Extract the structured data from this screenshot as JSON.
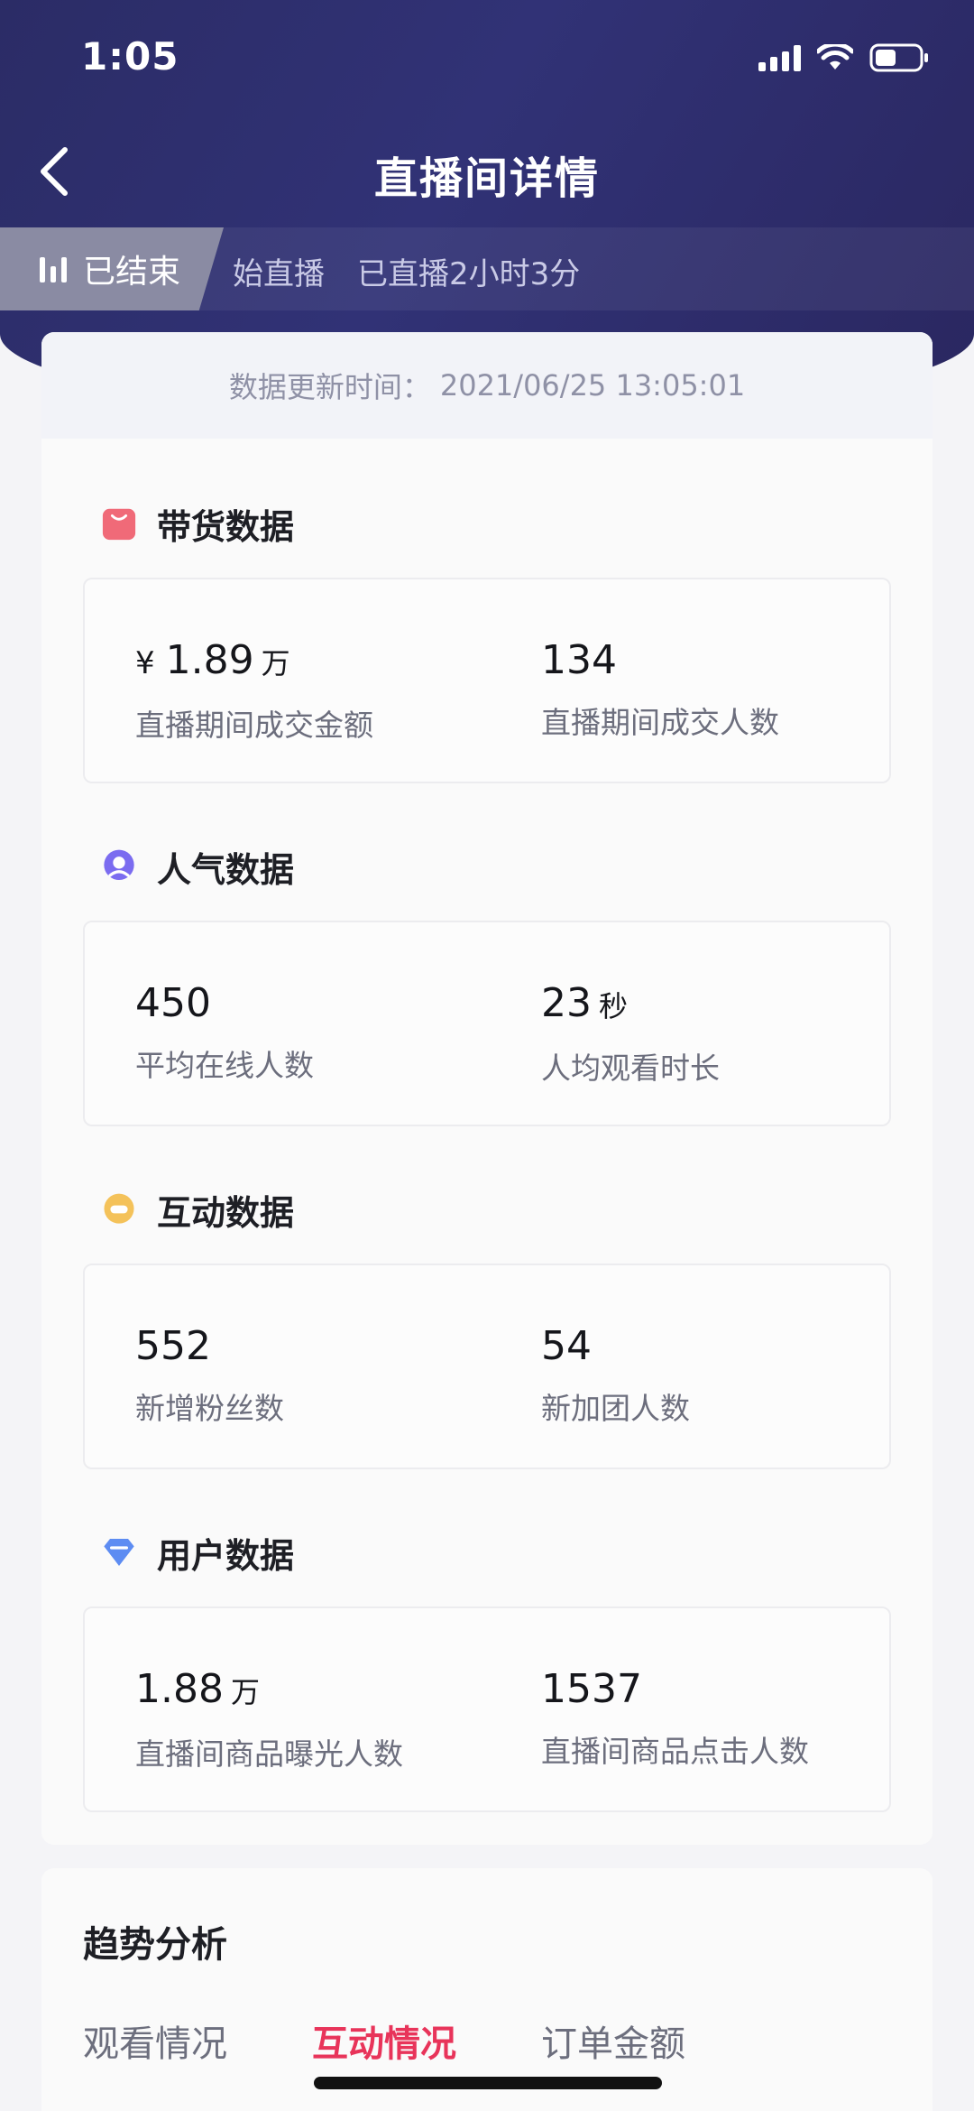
{
  "status_bar": {
    "time": "1:05"
  },
  "nav": {
    "title": "直播间详情"
  },
  "live": {
    "status": "已结束",
    "start_text": "始直播",
    "duration_text": "已直播2小时3分"
  },
  "update": {
    "label": "数据更新时间：",
    "value": "2021/06/25 13:05:01"
  },
  "sections": [
    {
      "title": "带货数据",
      "icon": "shopping-bag-icon",
      "color": "#f06a78",
      "stats": [
        {
          "prefix": "¥",
          "value": "1.89",
          "unit": "万",
          "label": "直播期间成交金额"
        },
        {
          "prefix": "",
          "value": "134",
          "unit": "",
          "label": "直播期间成交人数"
        }
      ]
    },
    {
      "title": "人气数据",
      "icon": "people-icon",
      "color": "#7b6cf0",
      "stats": [
        {
          "prefix": "",
          "value": "450",
          "unit": "",
          "label": "平均在线人数"
        },
        {
          "prefix": "",
          "value": "23",
          "unit": "秒",
          "label": "人均观看时长"
        }
      ]
    },
    {
      "title": "互动数据",
      "icon": "chat-bubble-icon",
      "color": "#f4c25a",
      "stats": [
        {
          "prefix": "",
          "value": "552",
          "unit": "",
          "label": "新增粉丝数"
        },
        {
          "prefix": "",
          "value": "54",
          "unit": "",
          "label": "新加团人数"
        }
      ]
    },
    {
      "title": "用户数据",
      "icon": "diamond-icon",
      "color": "#5d8cf2",
      "stats": [
        {
          "prefix": "",
          "value": "1.88",
          "unit": "万",
          "label": "直播间商品曝光人数"
        },
        {
          "prefix": "",
          "value": "1537",
          "unit": "",
          "label": "直播间商品点击人数"
        }
      ]
    }
  ],
  "trend": {
    "title": "趋势分析",
    "tabs": [
      "观看情况",
      "互动情况",
      "订单金额"
    ],
    "active_tab": "互动情况"
  }
}
